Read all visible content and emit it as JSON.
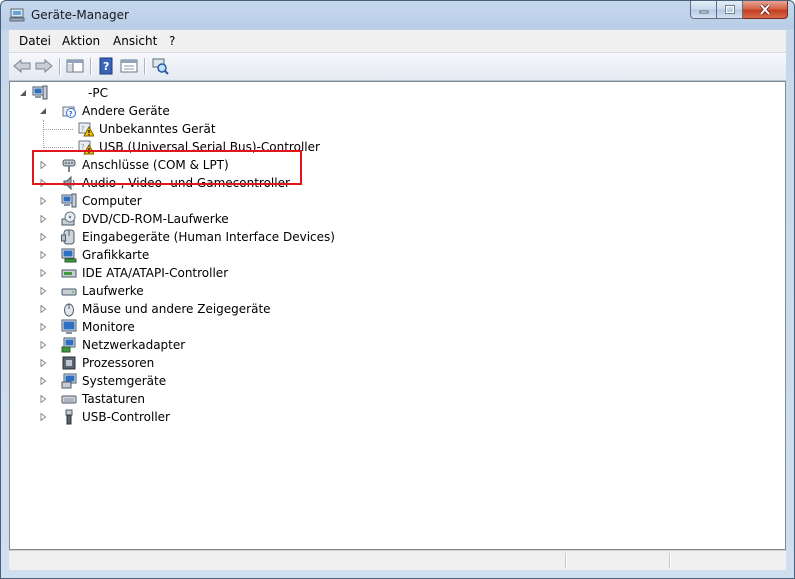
{
  "window": {
    "title": "Geräte-Manager"
  },
  "menu": {
    "items": [
      "Datei",
      "Aktion",
      "Ansicht",
      "?"
    ]
  },
  "colors": {
    "highlight_box": "#e2151c",
    "warning": "#f4c400",
    "title_bg": "#c5d8ee"
  },
  "tree": {
    "root": {
      "label": "-PC",
      "icon": "computer-icon",
      "expanded": true
    },
    "nodes": [
      {
        "label": "Andere Geräte",
        "icon": "unknown-device-icon",
        "expanded": true,
        "level": 1
      },
      {
        "label": "Unbekanntes Gerät",
        "icon": "warning-device-icon",
        "level": 2
      },
      {
        "label": "USB (Universal Serial Bus)-Controller",
        "icon": "warning-device-icon",
        "level": 2
      },
      {
        "label": "Anschlüsse (COM & LPT)",
        "icon": "port-icon",
        "level": 1
      },
      {
        "label": "Audio-, Video- und Gamecontroller",
        "icon": "speaker-icon",
        "level": 1
      },
      {
        "label": "Computer",
        "icon": "computer-icon",
        "level": 1
      },
      {
        "label": "DVD/CD-ROM-Laufwerke",
        "icon": "disc-drive-icon",
        "level": 1
      },
      {
        "label": "Eingabegeräte (Human Interface Devices)",
        "icon": "hid-icon",
        "level": 1
      },
      {
        "label": "Grafikkarte",
        "icon": "display-adapter-icon",
        "level": 1
      },
      {
        "label": "IDE ATA/ATAPI-Controller",
        "icon": "ide-controller-icon",
        "level": 1
      },
      {
        "label": "Laufwerke",
        "icon": "hard-drive-icon",
        "level": 1
      },
      {
        "label": "Mäuse und andere Zeigegeräte",
        "icon": "mouse-icon",
        "level": 1
      },
      {
        "label": "Monitore",
        "icon": "monitor-icon",
        "level": 1
      },
      {
        "label": "Netzwerkadapter",
        "icon": "network-adapter-icon",
        "level": 1
      },
      {
        "label": "Prozessoren",
        "icon": "processor-icon",
        "level": 1
      },
      {
        "label": "Systemgeräte",
        "icon": "system-device-icon",
        "level": 1
      },
      {
        "label": "Tastaturen",
        "icon": "keyboard-icon",
        "level": 1
      },
      {
        "label": "USB-Controller",
        "icon": "usb-icon",
        "level": 1
      }
    ]
  }
}
